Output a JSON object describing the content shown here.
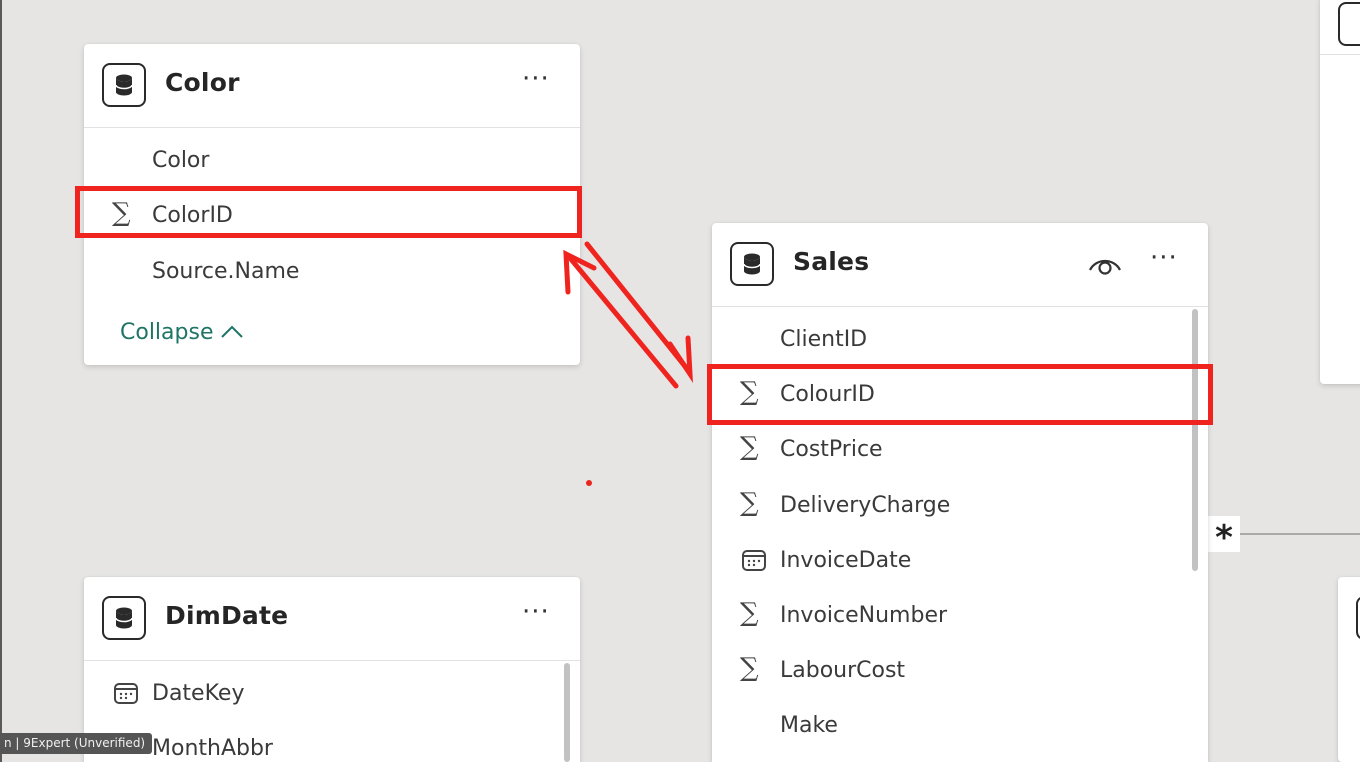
{
  "colors": {
    "canvas_bg": "#e6e5e4",
    "highlight": "#f0241e",
    "accent_teal": "#1e7566"
  },
  "tables": {
    "color": {
      "title": "Color",
      "more_label": "···",
      "fields": [
        {
          "name": "Color",
          "icon": "none"
        },
        {
          "name": "ColorID",
          "icon": "sigma-icon",
          "glyph": "∑"
        },
        {
          "name": "Source.Name",
          "icon": "none"
        }
      ],
      "collapse_label": "Collapse",
      "collapse_glyph": "^"
    },
    "sales": {
      "title": "Sales",
      "more_label": "···",
      "fields": [
        {
          "name": "ClientID",
          "icon": "none"
        },
        {
          "name": "ColourID",
          "icon": "sigma-icon",
          "glyph": "∑"
        },
        {
          "name": "CostPrice",
          "icon": "sigma-icon",
          "glyph": "∑"
        },
        {
          "name": "DeliveryCharge",
          "icon": "sigma-icon",
          "glyph": "∑"
        },
        {
          "name": "InvoiceDate",
          "icon": "calendar-icon"
        },
        {
          "name": "InvoiceNumber",
          "icon": "sigma-icon",
          "glyph": "∑"
        },
        {
          "name": "LabourCost",
          "icon": "sigma-icon",
          "glyph": "∑"
        },
        {
          "name": "Make",
          "icon": "none"
        }
      ]
    },
    "dimdate": {
      "title": "DimDate",
      "more_label": "···",
      "fields": [
        {
          "name": "DateKey",
          "icon": "calendar-icon"
        },
        {
          "name": "MonthAbbr",
          "icon": "none"
        }
      ]
    }
  },
  "relationship": {
    "cardinality_label": "*"
  },
  "watermark": {
    "text": "n | 9Expert (Unverified)"
  }
}
